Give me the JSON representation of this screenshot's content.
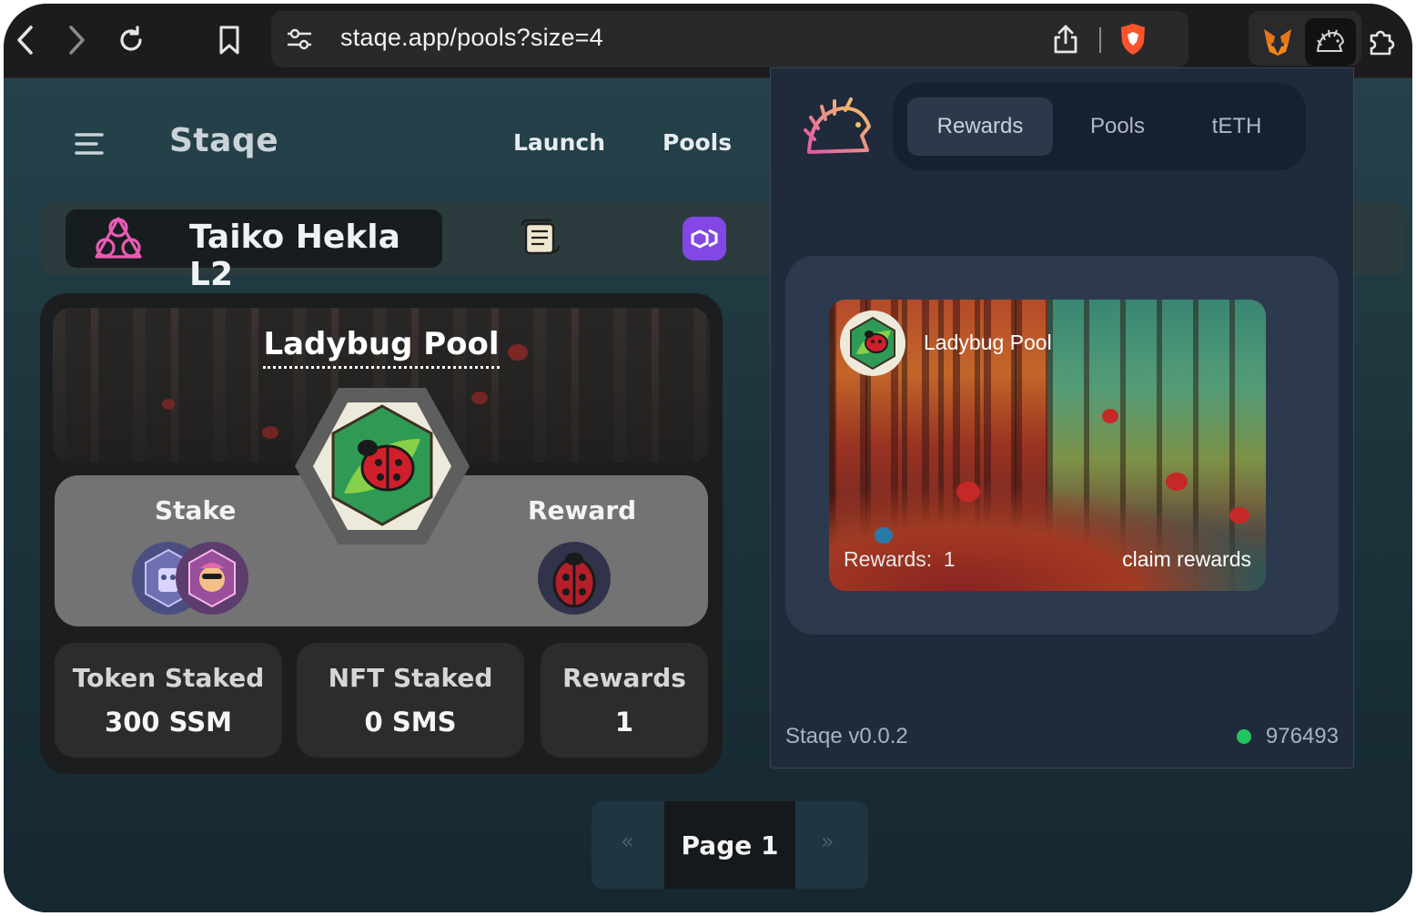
{
  "browser": {
    "url": "staqe.app/pools?size=4"
  },
  "app": {
    "brand": "Staqe",
    "nav": [
      "Launch",
      "Pools"
    ],
    "chain": "Taiko Hekla L2"
  },
  "pool": {
    "title": "Ladybug Pool",
    "stake_label": "Stake",
    "reward_label": "Reward",
    "stats": [
      {
        "title": "Token Staked",
        "value": "300 SSM"
      },
      {
        "title": "NFT Staked",
        "value": "0 SMS"
      },
      {
        "title": "Rewards",
        "value": "1"
      }
    ]
  },
  "pagination": {
    "prev": "«",
    "current": "Page 1",
    "next": "»"
  },
  "popup": {
    "tabs": [
      "Rewards",
      "Pools",
      "tETH"
    ],
    "active_tab": "Rewards",
    "card": {
      "title": "Ladybug Pool",
      "rewards_text": "Rewards:  1",
      "claim": "claim rewards"
    },
    "version": "Staqe v0.0.2",
    "block": "976493",
    "status_color": "#22c55e"
  }
}
